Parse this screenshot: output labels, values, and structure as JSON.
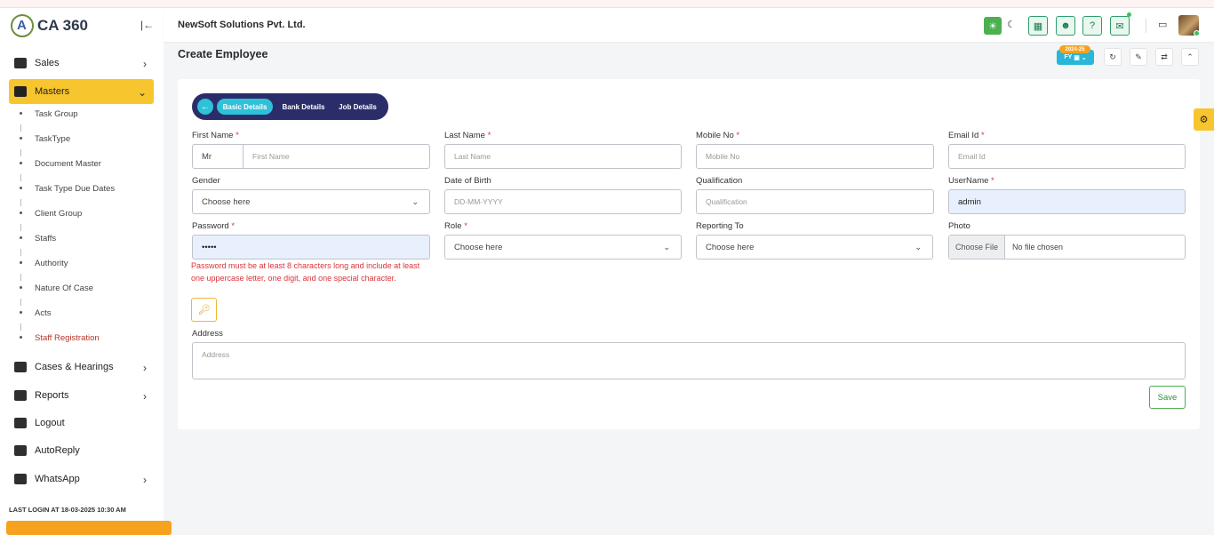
{
  "app": {
    "logo_text": "CA 360",
    "company": "NewSoft Solutions Pvt. Ltd."
  },
  "sidebar": {
    "items": [
      {
        "label": "Sales"
      },
      {
        "label": "Masters"
      },
      {
        "label": "Cases & Hearings"
      },
      {
        "label": "Reports"
      },
      {
        "label": "Logout"
      },
      {
        "label": "AutoReply"
      },
      {
        "label": "WhatsApp"
      }
    ],
    "submenu": [
      "Task Group",
      "TaskType",
      "Document Master",
      "Task Type Due Dates",
      "Client Group",
      "Staffs",
      "Authority",
      "Nature Of Case",
      "Acts",
      "Staff Registration"
    ],
    "last_login": "LAST LOGIN AT 18-03-2025 10:30 AM"
  },
  "page": {
    "title": "Create Employee",
    "fy_tag": "2024-25",
    "fy_label": "FY"
  },
  "tabs": [
    "Basic Details",
    "Bank Details",
    "Job Details"
  ],
  "form": {
    "first_name": {
      "label": "First Name",
      "title_value": "Mr",
      "placeholder": "First Name"
    },
    "last_name": {
      "label": "Last Name",
      "placeholder": "Last Name"
    },
    "mobile": {
      "label": "Mobile No",
      "placeholder": "Mobile No"
    },
    "email": {
      "label": "Email Id",
      "placeholder": "Email Id"
    },
    "gender": {
      "label": "Gender",
      "value": "Choose here"
    },
    "dob": {
      "label": "Date of Birth",
      "placeholder": "DD-MM-YYYY"
    },
    "qualification": {
      "label": "Qualification",
      "placeholder": "Qualification"
    },
    "username": {
      "label": "UserName",
      "value": "admin"
    },
    "password": {
      "label": "Password",
      "value": "•••••"
    },
    "role": {
      "label": "Role",
      "value": "Choose here"
    },
    "reporting_to": {
      "label": "Reporting To",
      "value": "Choose here"
    },
    "photo": {
      "label": "Photo",
      "button": "Choose File",
      "status": "No file chosen"
    },
    "password_error": "Password must be at least 8 characters long and include at least one uppercase letter, one digit, and one special character.",
    "address": {
      "label": "Address",
      "placeholder": "Address"
    },
    "save_label": "Save",
    "required_mark": "*"
  }
}
